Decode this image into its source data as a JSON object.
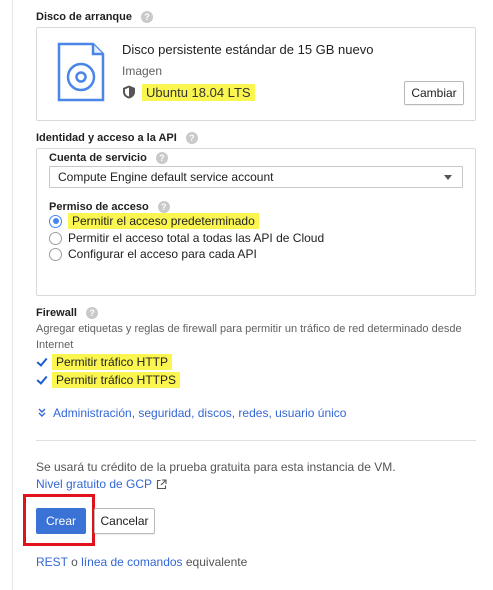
{
  "boot_disk": {
    "title": "Disco de arranque",
    "disk_name": "Disco persistente estándar de 15 GB nuevo",
    "image_label": "Imagen",
    "image_name": "Ubuntu 18.04 LTS",
    "change_button": "Cambiar"
  },
  "identity": {
    "title": "Identidad y acceso a la API",
    "service_account_label": "Cuenta de servicio",
    "service_account_value": "Compute Engine default service account",
    "scopes_label": "Permiso de acceso",
    "scopes": [
      {
        "label": "Permitir el acceso predeterminado",
        "selected": true
      },
      {
        "label": "Permitir el acceso total a todas las API de Cloud",
        "selected": false
      },
      {
        "label": "Configurar el acceso para cada API",
        "selected": false
      }
    ]
  },
  "firewall": {
    "title": "Firewall",
    "description": "Agregar etiquetas y reglas de firewall para permitir un tráfico de red determinado desde Internet",
    "http_label": "Permitir tráfico HTTP",
    "https_label": "Permitir tráfico HTTPS"
  },
  "management_link": "Administración, seguridad, discos, redes, usuario único",
  "credit_notice": "Se usará tu crédito de la prueba gratuita para esta instancia de VM.",
  "free_tier_link": "Nivel gratuito de GCP",
  "actions": {
    "create": "Crear",
    "cancel": "Cancelar"
  },
  "equivalent": {
    "rest": "REST",
    "or": " o ",
    "cli": "línea de comandos",
    "suffix": " equivalente"
  },
  "help_glyph": "?",
  "colors": {
    "link": "#3367d6",
    "primary_button": "#3a72d6",
    "highlight": "#fbf64f",
    "annotation_box": "#e0121b"
  }
}
